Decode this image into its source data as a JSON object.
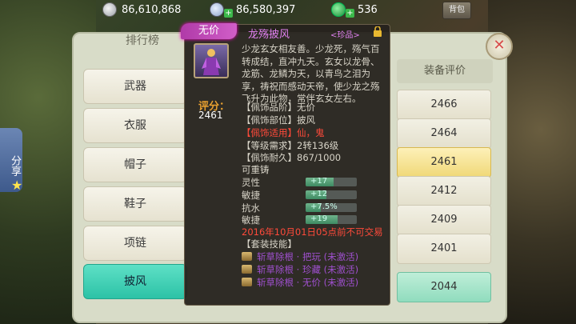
{
  "top": {
    "silver": "86,610,868",
    "coins": "86,580,397",
    "jade": "536",
    "button_label": "背包"
  },
  "share_label": "分享",
  "panel": {
    "title": "排行榜",
    "categories": [
      "武器",
      "衣服",
      "帽子",
      "鞋子",
      "项链",
      "披风"
    ],
    "active_category": "披风",
    "rank_header": "装备评价",
    "scores": [
      "2466",
      "2464",
      "2461",
      "2412",
      "2409",
      "2401",
      "2044"
    ]
  },
  "tooltip": {
    "grade": "无价",
    "name": "龙殇披风",
    "badge": "<珍品>",
    "description": "少龙玄女相友善。少龙死，殇气百转成结，直冲九天。玄女以龙骨、龙筋、龙鳞为天，以青鸟之泪为享，祷祝而感动天帝，使少龙之殇飞升为此物，常伴玄女左右。",
    "score_label": "评分：",
    "score_value": "2461",
    "info_lines": [
      "【佩饰品阶】无价",
      "【佩饰部位】披风",
      "【佩饰适用】仙，鬼",
      "【等级需求】2转136级",
      "【佩饰耐久】867/1000",
      "可重铸"
    ],
    "attributes": [
      {
        "name": "灵性",
        "value": "+17",
        "fraction": 0.55
      },
      {
        "name": "敏捷",
        "value": "+12",
        "fraction": 0.4
      },
      {
        "name": "抗水",
        "value": "+7.5%",
        "fraction": 0.3
      },
      {
        "name": "敏捷",
        "value": "+19",
        "fraction": 0.62
      }
    ],
    "trade_notice": "2016年10月01日05点前不可交易",
    "set_title": "【套装技能】",
    "skills": [
      "斩草除根 · 把玩 (未激活)",
      "斩草除根 · 珍藏 (未激活)",
      "斩草除根 · 无价 (未激活)"
    ]
  }
}
